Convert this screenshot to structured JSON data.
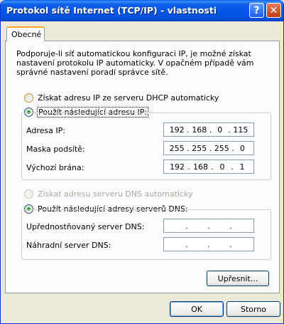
{
  "window": {
    "title": "Protokol sítě Internet (TCP/IP) - vlastnosti",
    "help_label": "?",
    "close_label": "✕"
  },
  "tabs": [
    {
      "label": "Obecné",
      "selected": true
    }
  ],
  "description": "Podporuje-li síť automatickou konfiguraci IP, je možné získat nastavení protokolu IP automaticky. V opačném případě vám správné nastavení poradí správce sítě.",
  "ip_mode": {
    "auto_label": "Získat adresu IP ze serveru DHCP automaticky",
    "manual_label": "Použít následující adresu IP:",
    "selected": "manual"
  },
  "ip_fields": [
    {
      "label": "Adresa IP:",
      "octets": [
        "192",
        "168",
        "0",
        "115"
      ]
    },
    {
      "label": "Maska podsítě:",
      "octets": [
        "255",
        "255",
        "255",
        "0"
      ]
    },
    {
      "label": "Výchozí brána:",
      "octets": [
        "192",
        "168",
        "0",
        "1"
      ]
    }
  ],
  "dns_mode": {
    "auto_label": "Získat adresu serveru DNS automaticky",
    "manual_label": "Použít následující adresy serverů DNS:",
    "selected": "manual",
    "auto_enabled": false
  },
  "dns_fields": [
    {
      "label": "Upřednostňovaný server DNS:",
      "octets": [
        "",
        "",
        "",
        ""
      ]
    },
    {
      "label": "Náhradní server DNS:",
      "octets": [
        "",
        "",
        "",
        ""
      ]
    }
  ],
  "buttons": {
    "advanced": "Upřesnit...",
    "ok": "OK",
    "cancel": "Storno"
  },
  "colors": {
    "titlebar": "#0055e5",
    "selected_radio": "#21a121",
    "tab_highlight": "#f5a623"
  }
}
